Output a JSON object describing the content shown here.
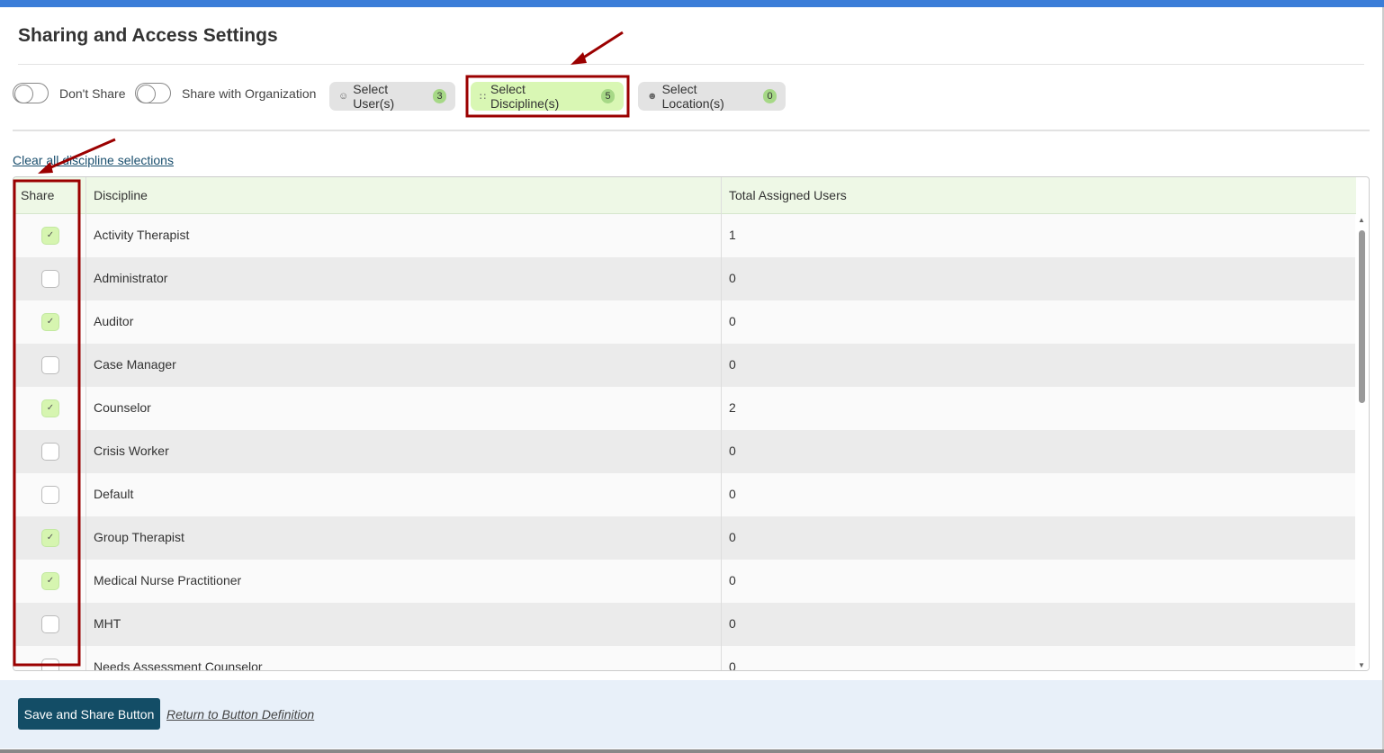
{
  "title": "Sharing and Access Settings",
  "toggles": {
    "dont_share": "Don't Share",
    "share_org": "Share with Organization"
  },
  "chips": [
    {
      "label": "Select User(s)",
      "count": "3",
      "icon": "user-icon"
    },
    {
      "label": "Select Discipline(s)",
      "count": "5",
      "icon": "discipline-icon"
    },
    {
      "label": "Select Location(s)",
      "count": "0",
      "icon": "location-icon"
    }
  ],
  "clear_link": "Clear all discipline selections",
  "table": {
    "headers": [
      "Share",
      "Discipline",
      "Total Assigned Users"
    ],
    "rows": [
      {
        "checked": true,
        "discipline": "Activity Therapist",
        "users": "1"
      },
      {
        "checked": false,
        "discipline": "Administrator",
        "users": "0"
      },
      {
        "checked": true,
        "discipline": "Auditor",
        "users": "0"
      },
      {
        "checked": false,
        "discipline": "Case Manager",
        "users": "0"
      },
      {
        "checked": true,
        "discipline": "Counselor",
        "users": "2"
      },
      {
        "checked": false,
        "discipline": "Crisis Worker",
        "users": "0"
      },
      {
        "checked": false,
        "discipline": "Default",
        "users": "0"
      },
      {
        "checked": true,
        "discipline": "Group Therapist",
        "users": "0"
      },
      {
        "checked": true,
        "discipline": "Medical Nurse Practitioner",
        "users": "0"
      },
      {
        "checked": false,
        "discipline": "MHT",
        "users": "0"
      },
      {
        "checked": false,
        "discipline": "Needs Assessment Counselor",
        "users": "0"
      }
    ]
  },
  "footer": {
    "save": "Save and Share Button",
    "return": "Return to Button Definition"
  },
  "colors": {
    "accent": "#134d66",
    "active_chip": "#d9f7b4",
    "annotation": "#9b0000"
  }
}
